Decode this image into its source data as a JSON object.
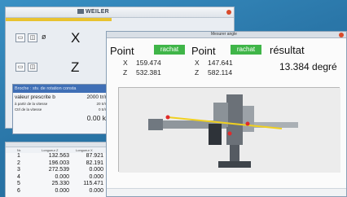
{
  "main_window": {
    "logo_text": "WEILER",
    "phi_symbol": "ø",
    "axis_x_label": "X",
    "axis_z_label": "Z",
    "param_panel": {
      "header": "Broche : stv. de rotation consta",
      "rows": [
        {
          "label": "valeur prescrite b",
          "value": "2000 tr/min"
        }
      ],
      "small_rows": [
        {
          "label": "à partir de la vitesse",
          "value": "20 tr/min"
        },
        {
          "label": "Ctrl de la vitesse",
          "value": "0 tr/min"
        }
      ],
      "kw_value": "0.00",
      "kw_unit": "kW"
    }
  },
  "table_window": {
    "headers": [
      "Nr.",
      "Longueur Z",
      "Longueur X"
    ],
    "rows": [
      {
        "nr": "1",
        "z": "132.563",
        "x": "87.921"
      },
      {
        "nr": "2",
        "z": "196.003",
        "x": "82.191"
      },
      {
        "nr": "3",
        "z": "272.539",
        "x": "0.000"
      },
      {
        "nr": "4",
        "z": "0.000",
        "x": "0.000"
      },
      {
        "nr": "5",
        "z": "25.330",
        "x": "115.471"
      },
      {
        "nr": "6",
        "z": "0.000",
        "x": "0.000"
      }
    ]
  },
  "measure_window": {
    "title": "Mesurer angle",
    "point1": {
      "label": "Point",
      "button": "rachat",
      "x_label": "X",
      "x": "159.474",
      "z_label": "Z",
      "z": "532.381"
    },
    "point2": {
      "label": "Point",
      "button": "rachat",
      "x_label": "X",
      "x": "147.641",
      "z_label": "Z",
      "z": "582.114"
    },
    "result_label": "résultat",
    "result_value": "13.384 degré"
  },
  "colors": {
    "desktop": "#2f7fb0",
    "rachat_green": "#3fb548",
    "close_red": "#d94b2b",
    "header_blue": "#3f6fb6",
    "accent_yellow": "#e8c230"
  }
}
